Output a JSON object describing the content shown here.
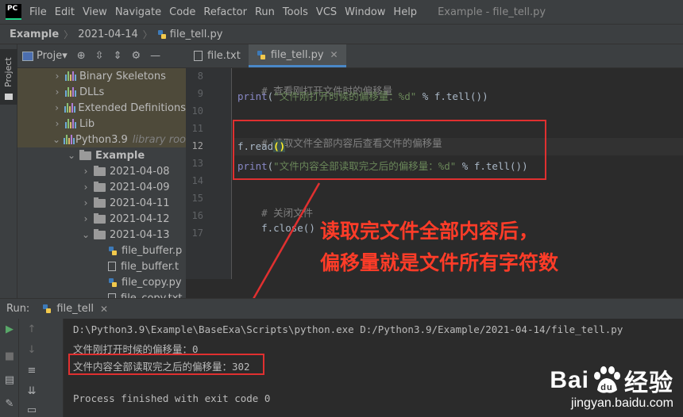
{
  "menubar": {
    "logo_text": "PC",
    "items": [
      "File",
      "Edit",
      "View",
      "Navigate",
      "Code",
      "Refactor",
      "Run",
      "Tools",
      "VCS",
      "Window",
      "Help"
    ],
    "window_title": "Example - file_tell.py"
  },
  "breadcrumb": {
    "project": "Example",
    "folder": "2021-04-14",
    "file": "file_tell.py"
  },
  "tool_strip": {
    "project_label": "Project"
  },
  "project_panel": {
    "label": "Proje▾",
    "tree": [
      {
        "label": "Binary Skeletons",
        "icon": "library-icon",
        "arrow": "right"
      },
      {
        "label": "DLLs",
        "icon": "library-icon",
        "arrow": "right"
      },
      {
        "label": "Extended Definitions",
        "icon": "library-icon",
        "arrow": "right"
      },
      {
        "label": "Lib",
        "icon": "library-icon",
        "arrow": "right"
      },
      {
        "label": "Python3.9",
        "extra": "library roo",
        "icon": "library-icon",
        "arrow": "down"
      },
      {
        "label": "Example",
        "icon": "folder-icon",
        "arrow": "down",
        "bold": true
      },
      {
        "label": "2021-04-08",
        "icon": "folder-icon",
        "arrow": "right"
      },
      {
        "label": "2021-04-09",
        "icon": "folder-icon",
        "arrow": "right"
      },
      {
        "label": "2021-04-11",
        "icon": "folder-icon",
        "arrow": "right"
      },
      {
        "label": "2021-04-12",
        "icon": "folder-icon",
        "arrow": "right"
      },
      {
        "label": "2021-04-13",
        "icon": "folder-icon",
        "arrow": "down"
      },
      {
        "label": "file_buffer.p",
        "icon": "python-file-icon",
        "arrow": "none"
      },
      {
        "label": "file_buffer.t",
        "icon": "text-file-icon",
        "arrow": "none"
      },
      {
        "label": "file_copy.py",
        "icon": "python-file-icon",
        "arrow": "none"
      },
      {
        "label": "file_copy.txt",
        "icon": "text-file-icon",
        "arrow": "none"
      }
    ]
  },
  "editor_tabs": [
    {
      "label": "file.txt",
      "active": false
    },
    {
      "label": "file_tell.py",
      "active": true
    }
  ],
  "editor": {
    "line_numbers": [
      "8",
      "9",
      "10",
      "11",
      "12",
      "13",
      "14",
      "15",
      "16",
      "17"
    ],
    "current_line": "12",
    "code": {
      "l8_comment": "# 查看刚打开文件时的偏移量",
      "l9_print": "print",
      "l9_open": "(",
      "l9_string": "\"文件刚打开时候的偏移量：%d\"",
      "l9_rest": " % f.tell())",
      "l11_comment": "# 读取文件全部内容后查看文件的偏移量",
      "l12_code": "f.read",
      "l12_parens": "()",
      "l13_print": "print",
      "l13_open": "(",
      "l13_string": "\"文件内容全部读取完之后的偏移量：%d\"",
      "l13_rest": " % f.tell())",
      "l15_comment": "# 关闭文件",
      "l16_code": "f.close()"
    }
  },
  "annotation": {
    "line1": "读取完文件全部内容后，",
    "line2": "偏移量就是文件所有字符数"
  },
  "run_panel": {
    "label": "Run:",
    "tab": "file_tell",
    "console": {
      "command": "D:\\Python3.9\\Example\\BaseExa\\Scripts\\python.exe D:/Python3.9/Example/2021-04-14/file_tell.py",
      "out1": "文件刚打开时候的偏移量：0",
      "out2": "文件内容全部读取完之后的偏移量：302",
      "exit": "Process finished with exit code 0"
    }
  },
  "watermark": {
    "brand_left": "Bai",
    "brand_paw": "du",
    "brand_right": "经验",
    "sub": "jingyan.baidu.com"
  },
  "colors": {
    "accent_blue": "#4a88c7",
    "annotation_red": "#ff3c28",
    "comment_gray": "#808080",
    "string_green": "#6a8759",
    "builtin_purple": "#8888c6"
  }
}
